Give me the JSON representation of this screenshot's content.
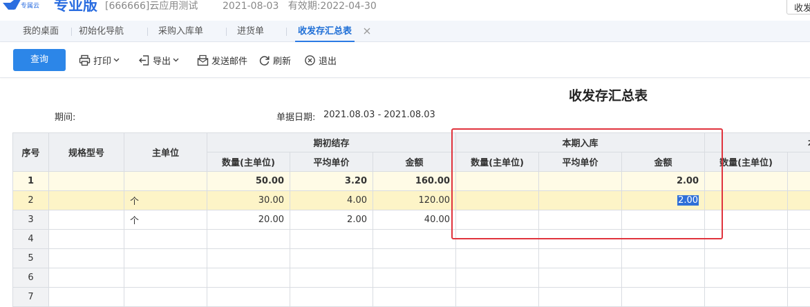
{
  "header": {
    "logo_text": "专属云",
    "edition": "专业版",
    "account": "[666666]云应用测试",
    "date_info": "2021-08-03   有效期:2022-04-30",
    "right_button": "收发"
  },
  "tabs": [
    {
      "label": "我的桌面"
    },
    {
      "label": "初始化导航"
    },
    {
      "label": "采购入库单"
    },
    {
      "label": "进货单"
    },
    {
      "label": "收发存汇总表",
      "active": true
    }
  ],
  "toolbar": {
    "query": "查询",
    "print": "打印",
    "export": "导出",
    "email": "发送邮件",
    "refresh": "刷新",
    "exit": "退出"
  },
  "report": {
    "title": "收发存汇总表",
    "period_label": "期间:",
    "date_label": "单据日期:",
    "date_range": "2021.08.03 - 2021.08.03"
  },
  "table": {
    "headers": {
      "seq": "序号",
      "spec": "规格型号",
      "unit": "主单位",
      "opening": "期初结存",
      "inbound": "本期入库",
      "outbound": "本",
      "qty": "数量(主单位)",
      "price": "平均单价",
      "amount": "金额"
    },
    "rows": [
      {
        "seq": "1",
        "spec": "",
        "unit": "",
        "o_qty": "50.00",
        "o_price": "3.20",
        "o_amount": "160.00",
        "i_qty": "",
        "i_price": "",
        "i_amount": "2.00",
        "out_qty": ""
      },
      {
        "seq": "2",
        "spec": "",
        "unit": "个",
        "o_qty": "30.00",
        "o_price": "4.00",
        "o_amount": "120.00",
        "i_qty": "",
        "i_price": "",
        "i_amount": "2.00",
        "out_qty": ""
      },
      {
        "seq": "3",
        "spec": "",
        "unit": "个",
        "o_qty": "20.00",
        "o_price": "2.00",
        "o_amount": "40.00",
        "i_qty": "",
        "i_price": "",
        "i_amount": "",
        "out_qty": ""
      },
      {
        "seq": "4",
        "spec": "",
        "unit": "",
        "o_qty": "",
        "o_price": "",
        "o_amount": "",
        "i_qty": "",
        "i_price": "",
        "i_amount": "",
        "out_qty": ""
      },
      {
        "seq": "5",
        "spec": "",
        "unit": "",
        "o_qty": "",
        "o_price": "",
        "o_amount": "",
        "i_qty": "",
        "i_price": "",
        "i_amount": "",
        "out_qty": ""
      },
      {
        "seq": "6",
        "spec": "",
        "unit": "",
        "o_qty": "",
        "o_price": "",
        "o_amount": "",
        "i_qty": "",
        "i_price": "",
        "i_amount": "",
        "out_qty": ""
      },
      {
        "seq": "7",
        "spec": "",
        "unit": "",
        "o_qty": "",
        "o_price": "",
        "o_amount": "",
        "i_qty": "",
        "i_price": "",
        "i_amount": "",
        "out_qty": ""
      }
    ]
  },
  "colors": {
    "accent": "#2c86e8",
    "highlight_box": "#e0323c",
    "selected_row": "#fdf4c7",
    "total_row": "#fffbe6"
  }
}
